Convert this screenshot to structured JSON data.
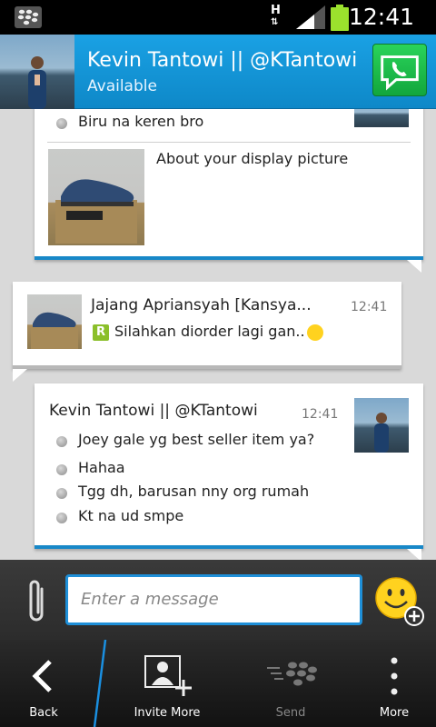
{
  "status_bar": {
    "time": "12:41",
    "network": "H",
    "icons": [
      "blackberry-icon",
      "network-h-icon",
      "signal-icon",
      "battery-icon"
    ]
  },
  "header": {
    "contact_name": "Kevin Tantowi || @KTantowi",
    "presence": "Available",
    "call_icon": "phone-icon"
  },
  "messages": [
    {
      "type": "outgoing",
      "items": [
        "Biru na keren bro"
      ],
      "attachment_caption": "About your display picture"
    },
    {
      "type": "incoming",
      "sender": "Jajang Apriansyah [Kansya...",
      "time": "12:41",
      "text": "Silahkan diorder lagi gan.."
    },
    {
      "type": "outgoing",
      "sender": "Kevin Tantowi || @KTantowi",
      "time": "12:41",
      "items": [
        "Joey gale yg best seller item ya?",
        "Hahaa",
        "Tgg dh, barusan nny org rumah",
        "Kt na ud smpe"
      ]
    }
  ],
  "composer": {
    "placeholder": "Enter a message"
  },
  "bottom_nav": {
    "back": "Back",
    "invite_more": "Invite More",
    "send": "Send",
    "more": "More"
  },
  "colors": {
    "header_blue": "#1aa1e4",
    "accent_blue": "#1888c8",
    "call_green": "#1fc24c"
  }
}
